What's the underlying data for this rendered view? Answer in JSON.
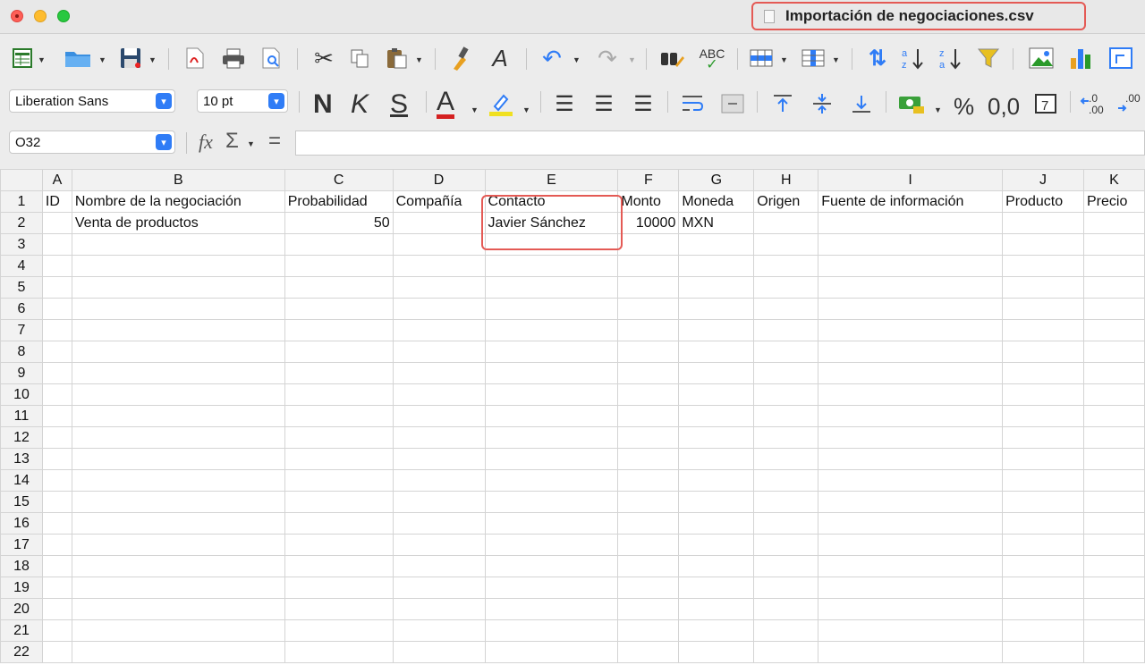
{
  "window": {
    "title": "Importación de negociaciones.csv"
  },
  "toolbar": {
    "font_name": "Liberation Sans",
    "font_size": "10 pt",
    "bold_label": "N",
    "italic_label": "K",
    "underline_label": "S",
    "font_color_label": "A",
    "percent_label": "%",
    "number_label": "0,0",
    "spell_label": "ABC"
  },
  "formula_bar": {
    "cell_ref": "O32",
    "fx_label": "fx",
    "sum_label": "Σ",
    "equals_label": "=",
    "formula_value": ""
  },
  "sheet": {
    "columns": [
      "A",
      "B",
      "C",
      "D",
      "E",
      "F",
      "G",
      "H",
      "I",
      "J",
      "K"
    ],
    "rows": [
      [
        "ID",
        "Nombre de la negociación",
        "Probabilidad",
        "Compañía",
        "Contacto",
        "Monto",
        "Moneda",
        "Origen",
        "Fuente de información",
        "Producto",
        "Precio"
      ],
      [
        "",
        "Venta de productos",
        "50",
        "",
        "Javier Sánchez",
        "10000",
        "MXN",
        "",
        "",
        "",
        ""
      ]
    ],
    "row_numbers": [
      "1",
      "2",
      "3",
      "4",
      "5",
      "6",
      "7",
      "8",
      "9",
      "10",
      "11",
      "12",
      "13",
      "14",
      "15",
      "16",
      "17",
      "18",
      "19",
      "20",
      "21",
      "22"
    ]
  },
  "colors": {
    "highlight": "#e45a55",
    "accent": "#2f7cf6"
  }
}
